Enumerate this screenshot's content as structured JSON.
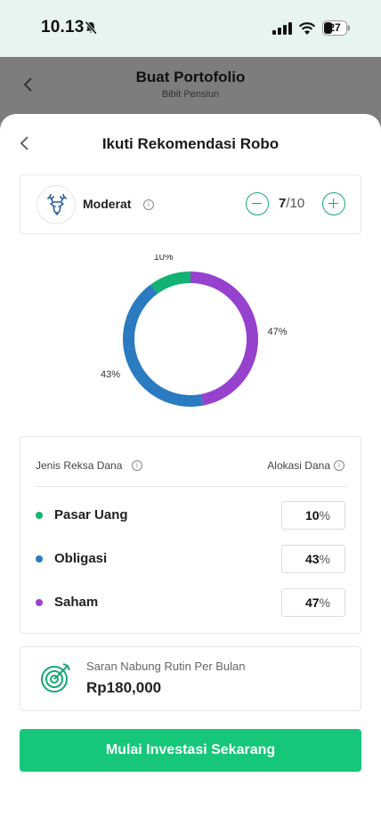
{
  "status_bar": {
    "time": "10.13",
    "battery": "27"
  },
  "background_page": {
    "title": "Buat Portofolio",
    "subtitle": "Bibit Pensiun"
  },
  "sheet": {
    "title": "Ikuti Rekomendasi Robo"
  },
  "risk_profile": {
    "name": "Moderat",
    "level_current": "7",
    "level_total": "/10"
  },
  "chart_data": {
    "type": "pie",
    "donut": true,
    "categories": [
      "Pasar Uang",
      "Obligasi",
      "Saham"
    ],
    "values": [
      10,
      43,
      47
    ],
    "labels": [
      "10%",
      "43%",
      "47%"
    ],
    "colors": [
      "#12b272",
      "#2a7bbf",
      "#9741cf"
    ]
  },
  "allocation": {
    "header_left": "Jenis Reksa Dana",
    "header_right": "Alokasi Dana",
    "rows": [
      {
        "name": "Pasar Uang",
        "value": "10",
        "unit": "%",
        "color": "#12b272"
      },
      {
        "name": "Obligasi",
        "value": "43",
        "unit": "%",
        "color": "#2a7bbf"
      },
      {
        "name": "Saham",
        "value": "47",
        "unit": "%",
        "color": "#9741cf"
      }
    ]
  },
  "saving": {
    "label": "Saran Nabung Rutin Per Bulan",
    "value": "Rp180,000"
  },
  "cta_label": "Mulai Investasi Sekarang",
  "colors": {
    "accent_green": "#1aa874",
    "cta_green": "#16c77a"
  }
}
